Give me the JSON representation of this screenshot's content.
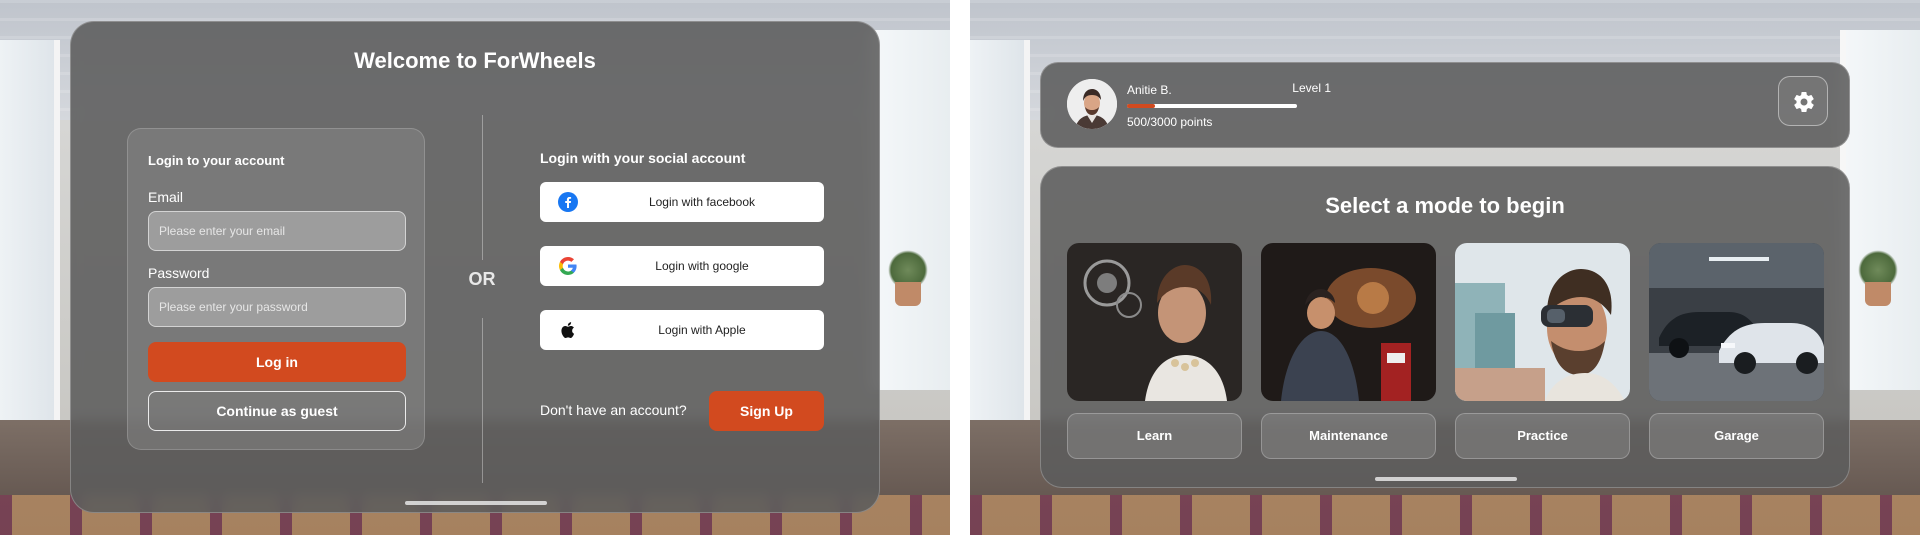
{
  "login_screen": {
    "title": "Welcome to ForWheels",
    "account": {
      "heading": "Login to your account",
      "email_label": "Email",
      "email_placeholder": "Please enter your email",
      "password_label": "Password",
      "password_placeholder": "Please enter your password",
      "login_button": "Log in",
      "guest_button": "Continue as guest"
    },
    "or_text": "OR",
    "social": {
      "heading": "Login with your social account",
      "facebook": "Login with facebook",
      "google": "Login with google",
      "apple": "Login with Apple"
    },
    "signup": {
      "prompt": "Don't have an account?",
      "button": "Sign Up"
    }
  },
  "mode_screen": {
    "profile": {
      "name": "Anitie B.",
      "level": "Level 1",
      "points": "500/3000 points",
      "progress_fraction": 0.1667
    },
    "title": "Select a mode to begin",
    "modes": [
      {
        "label": "Learn",
        "icon": "woman-hologram-image"
      },
      {
        "label": "Maintenance",
        "icon": "mechanic-image"
      },
      {
        "label": "Practice",
        "icon": "vr-headset-man-image"
      },
      {
        "label": "Garage",
        "icon": "parked-cars-image"
      }
    ]
  },
  "colors": {
    "accent": "#d24a1f",
    "panel": "#5c5c5c",
    "text": "#ffffff"
  }
}
